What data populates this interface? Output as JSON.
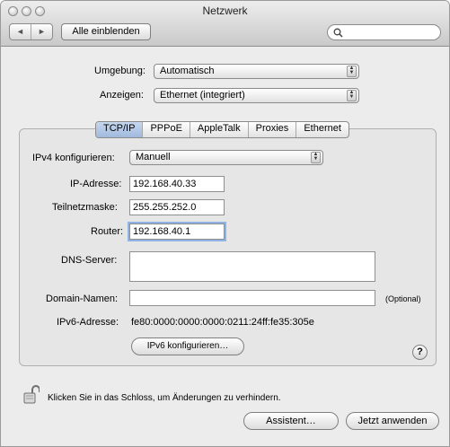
{
  "window": {
    "title": "Netzwerk"
  },
  "toolbar": {
    "back_icon": "◄",
    "forward_icon": "►",
    "show_all_label": "Alle einblenden",
    "search_placeholder": ""
  },
  "location": {
    "label": "Umgebung:",
    "value": "Automatisch"
  },
  "show": {
    "label": "Anzeigen:",
    "value": "Ethernet (integriert)"
  },
  "tabs": [
    {
      "label": "TCP/IP",
      "selected": true
    },
    {
      "label": "PPPoE"
    },
    {
      "label": "AppleTalk"
    },
    {
      "label": "Proxies"
    },
    {
      "label": "Ethernet"
    }
  ],
  "form": {
    "ipv4_label": "IPv4 konfigurieren:",
    "ipv4_value": "Manuell",
    "ip_label": "IP-Adresse:",
    "ip_value": "192.168.40.33",
    "subnet_label": "Teilnetzmaske:",
    "subnet_value": "255.255.252.0",
    "router_label": "Router:",
    "router_value": "192.168.40.1",
    "dns_label": "DNS-Server:",
    "dns_value": "",
    "domain_label": "Domain-Namen:",
    "domain_value": "",
    "optional_label": "(Optional)",
    "ipv6_label": "IPv6-Adresse:",
    "ipv6_value": "fe80:0000:0000:0000:0211:24ff:fe35:305e",
    "ipv6_button": "IPv6 konfigurieren…",
    "help": "?"
  },
  "footer": {
    "lock_text": "Klicken Sie in das Schloss, um Änderungen zu verhindern.",
    "assistant_button": "Assistent…",
    "apply_button": "Jetzt anwenden"
  }
}
